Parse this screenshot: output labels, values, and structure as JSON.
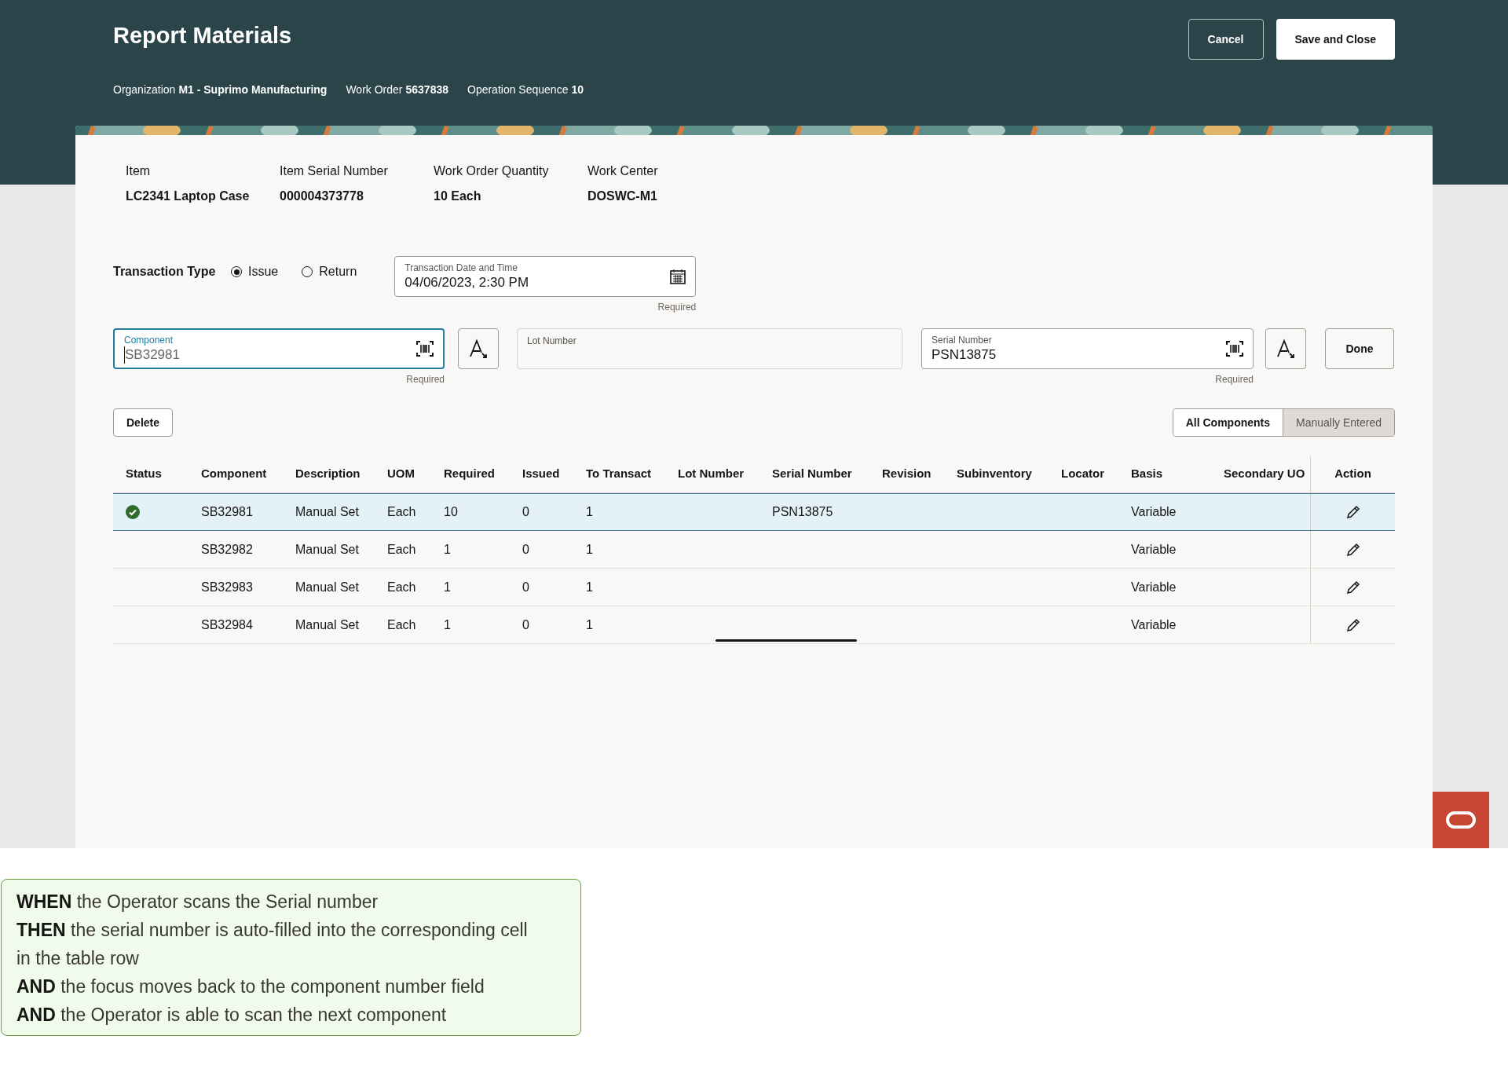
{
  "header": {
    "title": "Report Materials",
    "meta": [
      {
        "label": "Organization",
        "value": "M1 - Suprimo Manufacturing"
      },
      {
        "label": "Work Order",
        "value": "5637838"
      },
      {
        "label": "Operation Sequence",
        "value": "10"
      }
    ],
    "buttons": [
      {
        "label": "Cancel",
        "kind": "outline"
      },
      {
        "label": "Save and Close",
        "kind": "solid"
      }
    ]
  },
  "item_info": [
    {
      "label": "Item",
      "value": "LC2341 Laptop Case"
    },
    {
      "label": "Item Serial Number",
      "value": "000004373778"
    },
    {
      "label": "Work Order Quantity",
      "value": "10 Each"
    },
    {
      "label": "Work Center",
      "value": "DOSWC-M1"
    }
  ],
  "transaction_type": {
    "label": "Transaction Type",
    "options": [
      {
        "label": "Issue",
        "selected": true
      },
      {
        "label": "Return",
        "selected": false
      }
    ]
  },
  "date_field": {
    "label": "Transaction Date and Time",
    "value": "04/06/2023, 2:30 PM",
    "hint": "Required"
  },
  "component_field": {
    "label": "Component",
    "value": "SB32981",
    "hint": "Required",
    "focused": true
  },
  "lot_field": {
    "label": "Lot Number"
  },
  "serial_field": {
    "label": "Serial Number",
    "value": "PSN13875",
    "hint": "Required",
    "focused": false
  },
  "done_button": "Done",
  "delete_button": "Delete",
  "view_toggle": [
    {
      "label": "All Components",
      "selected": false
    },
    {
      "label": "Manually Entered",
      "selected": true
    }
  ],
  "table": {
    "columns": [
      "Status",
      "Component",
      "Description",
      "UOM",
      "Required",
      "Issued",
      "To Transact",
      "Lot Number",
      "Serial Number",
      "Revision",
      "Subinventory",
      "Locator",
      "Basis",
      "Secondary UO",
      "Action"
    ],
    "rows": [
      {
        "complete": true,
        "selected": true,
        "cells": [
          "",
          "SB32981",
          "Manual Set",
          "Each",
          "10",
          "0",
          "1",
          "",
          "PSN13875",
          "",
          "",
          "",
          "Variable",
          ""
        ]
      },
      {
        "complete": false,
        "selected": false,
        "cells": [
          "",
          "SB32982",
          "Manual Set",
          "Each",
          "1",
          "0",
          "1",
          "",
          "",
          "",
          "",
          "",
          "Variable",
          ""
        ]
      },
      {
        "complete": false,
        "selected": false,
        "cells": [
          "",
          "SB32983",
          "Manual Set",
          "Each",
          "1",
          "0",
          "1",
          "",
          "",
          "",
          "",
          "",
          "Variable",
          ""
        ]
      },
      {
        "complete": false,
        "selected": false,
        "cells": [
          "",
          "SB32984",
          "Manual Set",
          "Each",
          "1",
          "0",
          "1",
          "",
          "",
          "",
          "",
          "",
          "Variable",
          ""
        ]
      }
    ]
  },
  "callout": [
    "**WHEN** the Operator scans the Serial number",
    "**THEN** the serial number is auto-filled into the corresponding cell",
    "in the table row",
    "**AND** the focus moves back to the component number field",
    "**AND** the Operator is able to scan the next component"
  ]
}
